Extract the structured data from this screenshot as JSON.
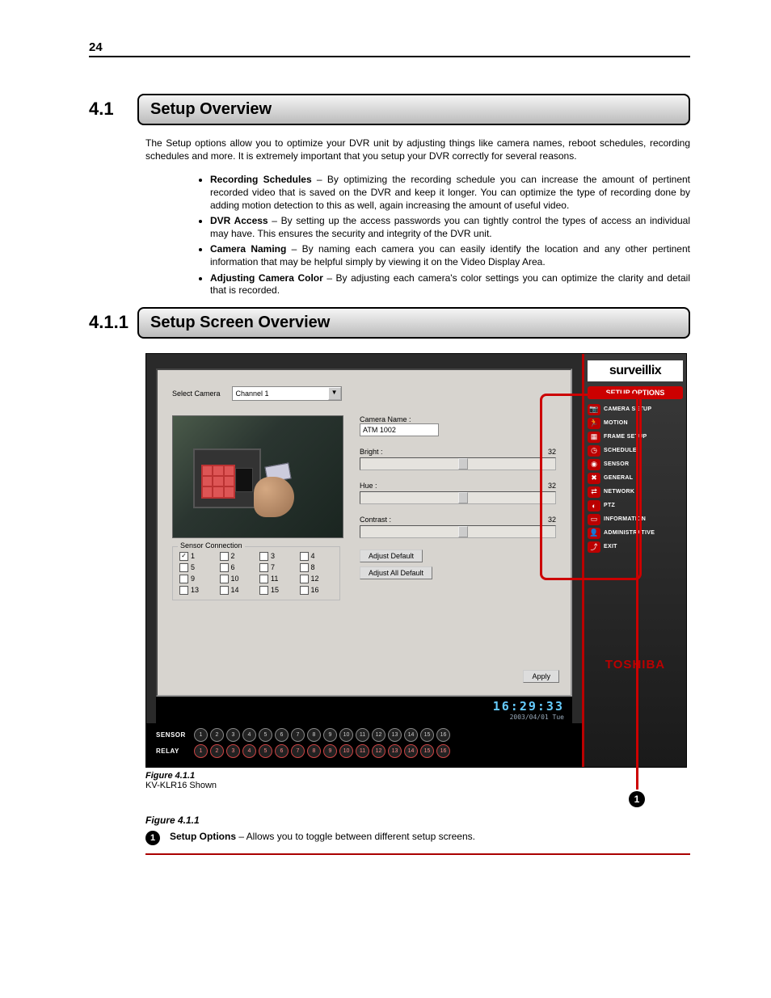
{
  "page": {
    "num": "24"
  },
  "s1": {
    "num": "4.1",
    "title": "Setup Overview",
    "intro": "The Setup options allow you to optimize your DVR unit by adjusting things like camera names, reboot schedules, recording schedules and more. It is extremely important that you setup your DVR correctly for several reasons.",
    "bullets": [
      {
        "b": "Recording Schedules",
        "t": " – By optimizing the recording schedule you can increase the amount of pertinent recorded video that is saved on the DVR and keep it longer. You can optimize the type of recording done by adding motion detection to this as well, again increasing the amount of useful video."
      },
      {
        "b": "DVR Access",
        "t": " – By setting up the access passwords you can tightly control the types of access an individual may have. This ensures the security and integrity of the DVR unit."
      },
      {
        "b": "Camera Naming",
        "t": " – By naming each camera you can easily identify the location and any other pertinent information that may be helpful simply by viewing it on the Video Display Area."
      },
      {
        "b": "Adjusting Camera Color",
        "t": " – By adjusting each camera's color settings you can optimize the clarity and detail that is recorded."
      }
    ]
  },
  "s2": {
    "num": "4.1.1",
    "title": "Setup Screen Overview"
  },
  "app": {
    "logo": "surveillix",
    "optHdr": "SETUP OPTIONS",
    "opts": [
      {
        "ic": "📷",
        "lb": "CAMERA SETUP"
      },
      {
        "ic": "🏃",
        "lb": "MOTION"
      },
      {
        "ic": "▦",
        "lb": "FRAME SETUP"
      },
      {
        "ic": "◷",
        "lb": "SCHEDULE"
      },
      {
        "ic": "◉",
        "lb": "SENSOR"
      },
      {
        "ic": "✖",
        "lb": "GENERAL"
      },
      {
        "ic": "⇄",
        "lb": "NETWORK"
      },
      {
        "ic": "◐",
        "lb": "PTZ"
      },
      {
        "ic": "▭",
        "lb": "INFORMATION"
      },
      {
        "ic": "👤",
        "lb": "ADMINISTRATIVE"
      },
      {
        "ic": "⤴",
        "lb": "EXIT"
      }
    ],
    "brand": "TOSHIBA",
    "selCam": {
      "lbl": "Select Camera",
      "val": "Channel 1"
    },
    "camName": {
      "lbl": "Camera Name :",
      "val": "ATM 1002"
    },
    "bright": {
      "lbl": "Bright :",
      "val": "32"
    },
    "hue": {
      "lbl": "Hue :",
      "val": "32"
    },
    "contrast": {
      "lbl": "Contrast :",
      "val": "32"
    },
    "adjDef": "Adjust Default",
    "adjAll": "Adjust All Default",
    "apply": "Apply",
    "sensorTitle": "Sensor Connection",
    "sensors": [
      "1",
      "2",
      "3",
      "4",
      "5",
      "6",
      "7",
      "8",
      "9",
      "10",
      "11",
      "12",
      "13",
      "14",
      "15",
      "16"
    ],
    "clock": {
      "t": "16:29:33",
      "d": "2003/04/01 Tue"
    },
    "ioSensor": "SENSOR",
    "ioRelay": "RELAY",
    "ioNums": [
      "1",
      "2",
      "3",
      "4",
      "5",
      "6",
      "7",
      "8",
      "9",
      "10",
      "11",
      "12",
      "13",
      "14",
      "15",
      "16"
    ]
  },
  "fig": {
    "label": "Figure 4.1.1",
    "sub": "KV-KLR16 Shown",
    "ref": "Figure 4.1.1",
    "note": {
      "n": "1",
      "b": "Setup Options",
      "t": " – Allows you to toggle between different setup screens."
    }
  }
}
